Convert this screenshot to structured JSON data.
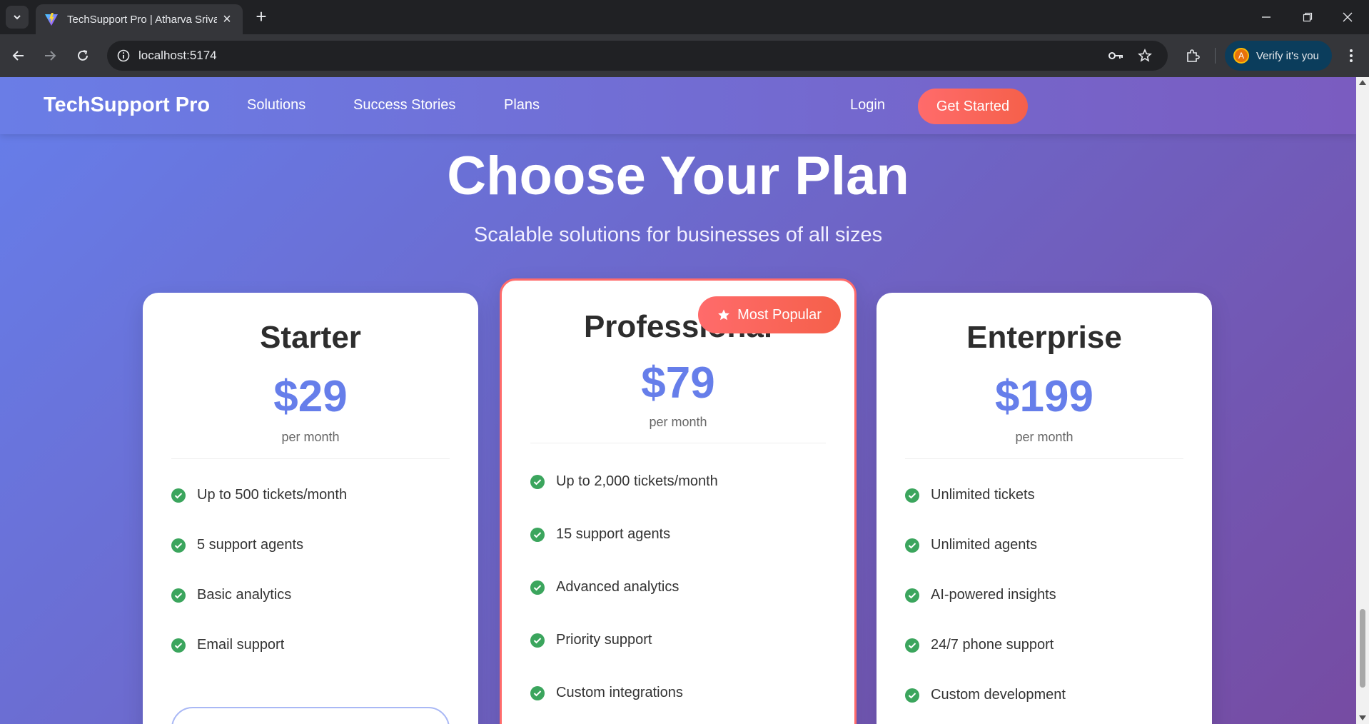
{
  "browser": {
    "tab_title": "TechSupport Pro | Atharva Srivastava",
    "url": "localhost:5174",
    "profile_initial": "A",
    "profile_label": "Verify it's you"
  },
  "header": {
    "brand": "TechSupport Pro",
    "nav": [
      "Solutions",
      "Success Stories",
      "Plans"
    ],
    "login": "Login",
    "cta": "Get Started"
  },
  "hero": {
    "title": "Choose Your Plan",
    "subtitle": "Scalable solutions for businesses of all sizes"
  },
  "plans": [
    {
      "name": "Starter",
      "price": "$29",
      "period": "per month",
      "features": [
        "Up to 500 tickets/month",
        "5 support agents",
        "Basic analytics",
        "Email support"
      ]
    },
    {
      "name": "Professional",
      "price": "$79",
      "period": "per month",
      "badge": "Most Popular",
      "features": [
        "Up to 2,000 tickets/month",
        "15 support agents",
        "Advanced analytics",
        "Priority support",
        "Custom integrations"
      ]
    },
    {
      "name": "Enterprise",
      "price": "$199",
      "period": "per month",
      "features": [
        "Unlimited tickets",
        "Unlimited agents",
        "AI-powered insights",
        "24/7 phone support",
        "Custom development"
      ]
    }
  ],
  "colors": {
    "accent": "#667eea",
    "brand_gradient_end": "#764ba2",
    "cta": "#ff6b6b",
    "check": "#3ba55d"
  }
}
